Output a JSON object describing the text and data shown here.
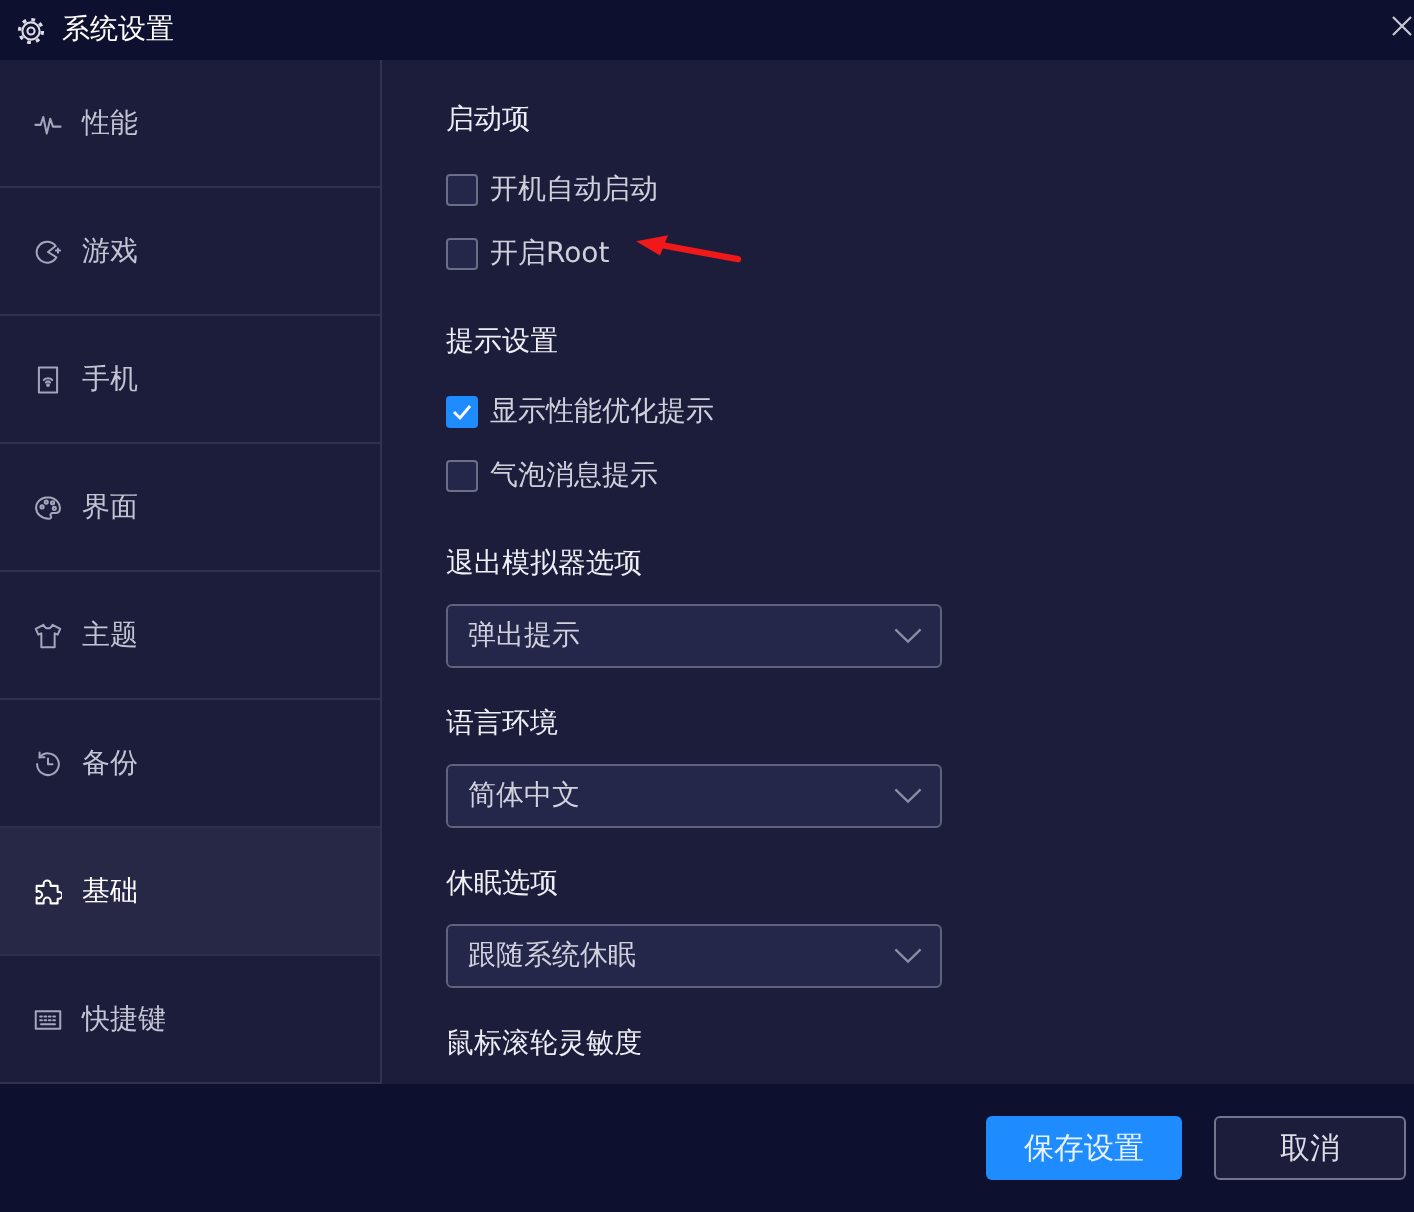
{
  "window": {
    "title": "系统设置"
  },
  "sidebar": {
    "items": [
      {
        "label": "性能",
        "selected": false
      },
      {
        "label": "游戏",
        "selected": false
      },
      {
        "label": "手机",
        "selected": false
      },
      {
        "label": "界面",
        "selected": false
      },
      {
        "label": "主题",
        "selected": false
      },
      {
        "label": "备份",
        "selected": false
      },
      {
        "label": "基础",
        "selected": true
      },
      {
        "label": "快捷键",
        "selected": false
      }
    ]
  },
  "sections": [
    {
      "title": "启动项",
      "kind": "checkboxes",
      "items": [
        {
          "label": "开机自动启动",
          "checked": false,
          "annotated": false
        },
        {
          "label": "开启Root",
          "checked": false,
          "annotated": true
        }
      ]
    },
    {
      "title": "提示设置",
      "kind": "checkboxes",
      "items": [
        {
          "label": "显示性能优化提示",
          "checked": true,
          "annotated": false
        },
        {
          "label": "气泡消息提示",
          "checked": false,
          "annotated": false
        }
      ]
    },
    {
      "title": "退出模拟器选项",
      "kind": "select",
      "value": "弹出提示"
    },
    {
      "title": "语言环境",
      "kind": "select",
      "value": "简体中文"
    },
    {
      "title": "休眠选项",
      "kind": "select",
      "value": "跟随系统休眠"
    },
    {
      "title": "鼠标滚轮灵敏度",
      "kind": "heading"
    }
  ],
  "buttons": [
    {
      "label": "保存设置",
      "kind": "primary"
    },
    {
      "label": "取消",
      "kind": "secondary"
    }
  ]
}
